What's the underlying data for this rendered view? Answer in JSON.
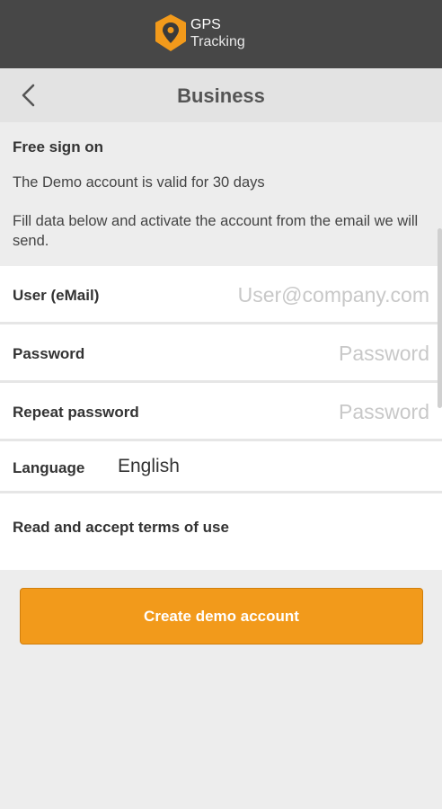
{
  "app": {
    "logo_line1": "GPS",
    "logo_line2": "Tracking",
    "logo_icon": "location-pin-icon"
  },
  "nav": {
    "title": "Business",
    "back_icon": "chevron-left-icon"
  },
  "info": {
    "heading": "Free sign on",
    "validity": "The Demo account is valid for 30 days",
    "instructions": "Fill data below and activate the account from the email we will send."
  },
  "form": {
    "user_label": "User (eMail)",
    "user_placeholder": "User@company.com",
    "password_label": "Password",
    "password_placeholder": "Password",
    "repeat_label": "Repeat password",
    "repeat_placeholder": "Password",
    "language_label": "Language",
    "language_value": "English",
    "terms_label": "Read and accept terms of use"
  },
  "actions": {
    "create_label": "Create demo account"
  },
  "colors": {
    "accent": "#f29a1b",
    "topbar": "#474747"
  }
}
